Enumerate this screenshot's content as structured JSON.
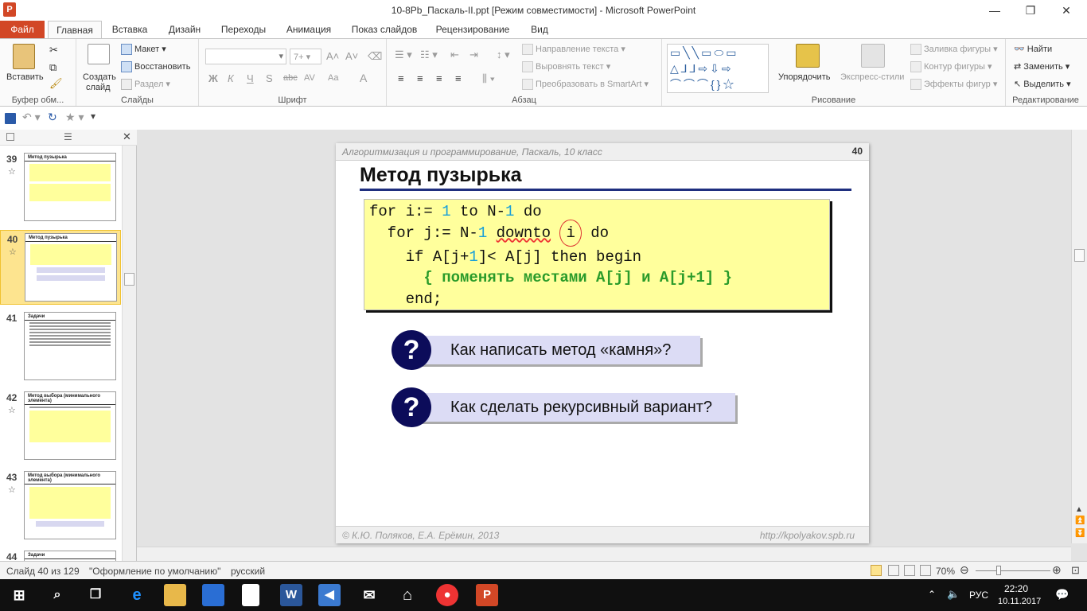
{
  "window": {
    "title": "10-8Pb_Паскаль-II.ppt [Режим совместимости] - Microsoft PowerPoint",
    "app_badge": "P",
    "minimize": "—",
    "restore": "❐",
    "close": "✕"
  },
  "tabs": [
    "Файл",
    "Главная",
    "Вставка",
    "Дизайн",
    "Переходы",
    "Анимация",
    "Показ слайдов",
    "Рецензирование",
    "Вид"
  ],
  "ribbon": {
    "clipboard": {
      "label": "Буфер обм...",
      "paste": "Вставить"
    },
    "slides": {
      "label": "Слайды",
      "new_slide_1": "Создать",
      "new_slide_2": "слайд",
      "layout": "Макет",
      "reset": "Восстановить",
      "section": "Раздел"
    },
    "font": {
      "label": "Шрифт",
      "size": "7+",
      "bold": "Ж",
      "italic": "К",
      "underline": "Ч",
      "shadow": "S",
      "strike": "abc",
      "spacing": "AV",
      "case": "Aa",
      "color": "A"
    },
    "paragraph": {
      "label": "Абзац",
      "text_direction": "Направление текста",
      "align_text": "Выровнять текст",
      "smartart": "Преобразовать в SmartArt"
    },
    "drawing": {
      "label": "Рисование",
      "arrange": "Упорядочить",
      "quick_styles": "Экспресс-стили",
      "shape_fill": "Заливка фигуры",
      "shape_outline": "Контур фигуры",
      "shape_effects": "Эффекты фигур"
    },
    "editing": {
      "label": "Редактирование",
      "find": "Найти",
      "replace": "Заменить",
      "select": "Выделить"
    }
  },
  "thumbnails": [
    {
      "num": "39",
      "title": "Метод пузырька"
    },
    {
      "num": "40",
      "title": "Метод пузырька"
    },
    {
      "num": "41",
      "title": "Задачи"
    },
    {
      "num": "42",
      "title": "Метод выбора (минимального элемента)"
    },
    {
      "num": "43",
      "title": "Метод выбора (минимального элемента)"
    },
    {
      "num": "44",
      "title": "Задачи"
    }
  ],
  "slide": {
    "course": "Алгоритмизация и программирование, Паскаль, 10 класс",
    "number": "40",
    "title": "Метод пузырька",
    "q1": "Как написать метод «камня»?",
    "q2": "Как сделать рекурсивный вариант?",
    "q_mark": "?",
    "footer_left": "© К.Ю. Поляков, Е.А. Ерёмин, 2013",
    "footer_right": "http://kpolyakov.spb.ru"
  },
  "code": {
    "l1_a": "for i:= ",
    "l1_n1": "1",
    "l1_b": " to N-",
    "l1_n2": "1",
    "l1_c": " do",
    "l2_a": "  for j:= N-",
    "l2_n1": "1",
    "l2_sp": " ",
    "l2_b": "downto",
    "l2_sp2": " ",
    "l2_i": "i",
    "l2_c": " do",
    "l3_a": "    if A[j+",
    "l3_n1": "1",
    "l3_b": "]< A[j] then begin",
    "l4_pre": "      ",
    "l4": "{ поменять местами A[j] и A[j+1] }",
    "l5": "    end;"
  },
  "status": {
    "slide_info": "Слайд 40 из 129",
    "theme": "\"Оформление по умолчанию\"",
    "language": "русский",
    "zoom": "70%"
  },
  "taskbar": {
    "time": "22:20",
    "date": "10.11.2017",
    "lang": "РУС"
  }
}
